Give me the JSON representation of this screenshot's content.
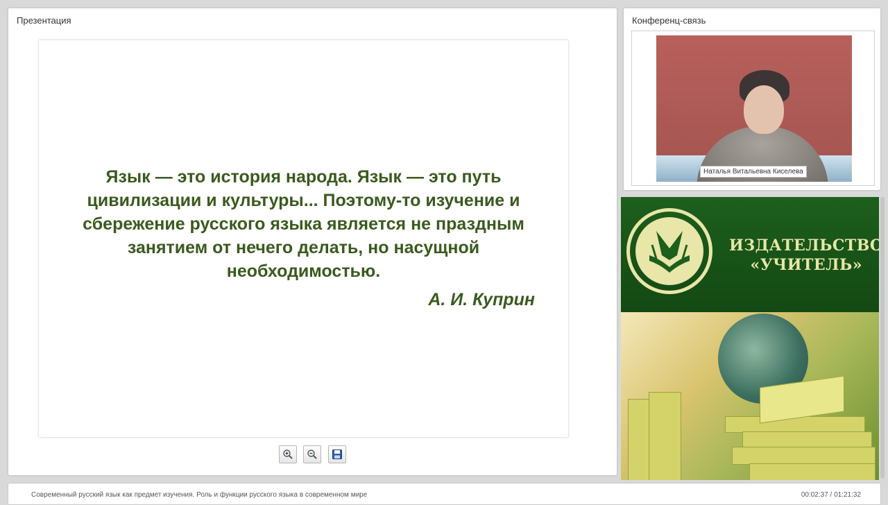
{
  "presentation": {
    "title": "Презентация",
    "slide": {
      "quote": "Язык — это история народа. Язык — это путь цивилизации и культуры... Поэтому-то изучение и сбережение русского языка является не праздным занятием от нечего делать, но насущной необходимостью.",
      "author": "А. И. Куприн",
      "text_color": "#3a5a1e"
    },
    "toolbar": {
      "zoom_in_icon": "zoom-in-icon",
      "zoom_out_icon": "zoom-out-icon",
      "save_icon": "save-icon"
    }
  },
  "conference": {
    "title": "Конференц-связь",
    "presenter_name": "Наталья Витальевна Киселева"
  },
  "banner": {
    "brand_line1": "ИЗДАТЕЛЬСТВО",
    "brand_line2": "«УЧИТЕЛЬ»",
    "brand_color": "#e8e6a8",
    "background_color": "#1d5f1d"
  },
  "footer": {
    "lecture_title": "Современный русский язык как предмет изучения. Роль и функции русского языка в современном мире",
    "timer": "00:02:37 / 01:21:32"
  }
}
